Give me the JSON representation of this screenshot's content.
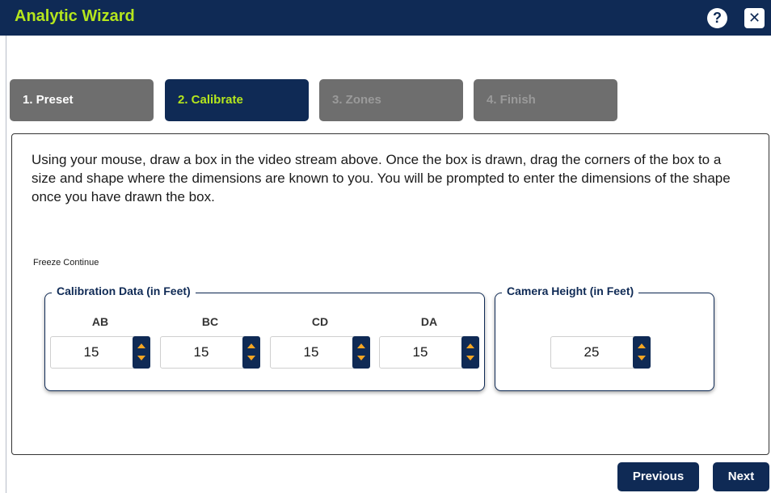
{
  "window": {
    "title": "Analytic Wizard",
    "help_label": "?",
    "close_label": "✕"
  },
  "steps": [
    {
      "label": "1. Preset",
      "state": "completed"
    },
    {
      "label": "2. Calibrate",
      "state": "active"
    },
    {
      "label": "3. Zones",
      "state": "disabled"
    },
    {
      "label": "4. Finish",
      "state": "disabled"
    }
  ],
  "main": {
    "instructions": "Using your mouse, draw a box in the video stream above. Once the box is drawn, drag the corners of the box to a size and shape where the dimensions are known to you. You will be prompted to enter the dimensions of the shape once you have drawn the box.",
    "freeze_continue": "Freeze Continue"
  },
  "calibration": {
    "legend": "Calibration Data (in Feet)",
    "fields": [
      {
        "label": "AB",
        "value": "15"
      },
      {
        "label": "BC",
        "value": "15"
      },
      {
        "label": "CD",
        "value": "15"
      },
      {
        "label": "DA",
        "value": "15"
      }
    ]
  },
  "camera": {
    "legend": "Camera Height (in Feet)",
    "value": "25"
  },
  "footer": {
    "previous_label": "Previous",
    "next_label": "Next"
  },
  "colors": {
    "navy": "#0f2a55",
    "accent_green": "#b5e61d",
    "step_inactive": "#6e6e6e",
    "spinner_arrow": "#f5a623"
  }
}
